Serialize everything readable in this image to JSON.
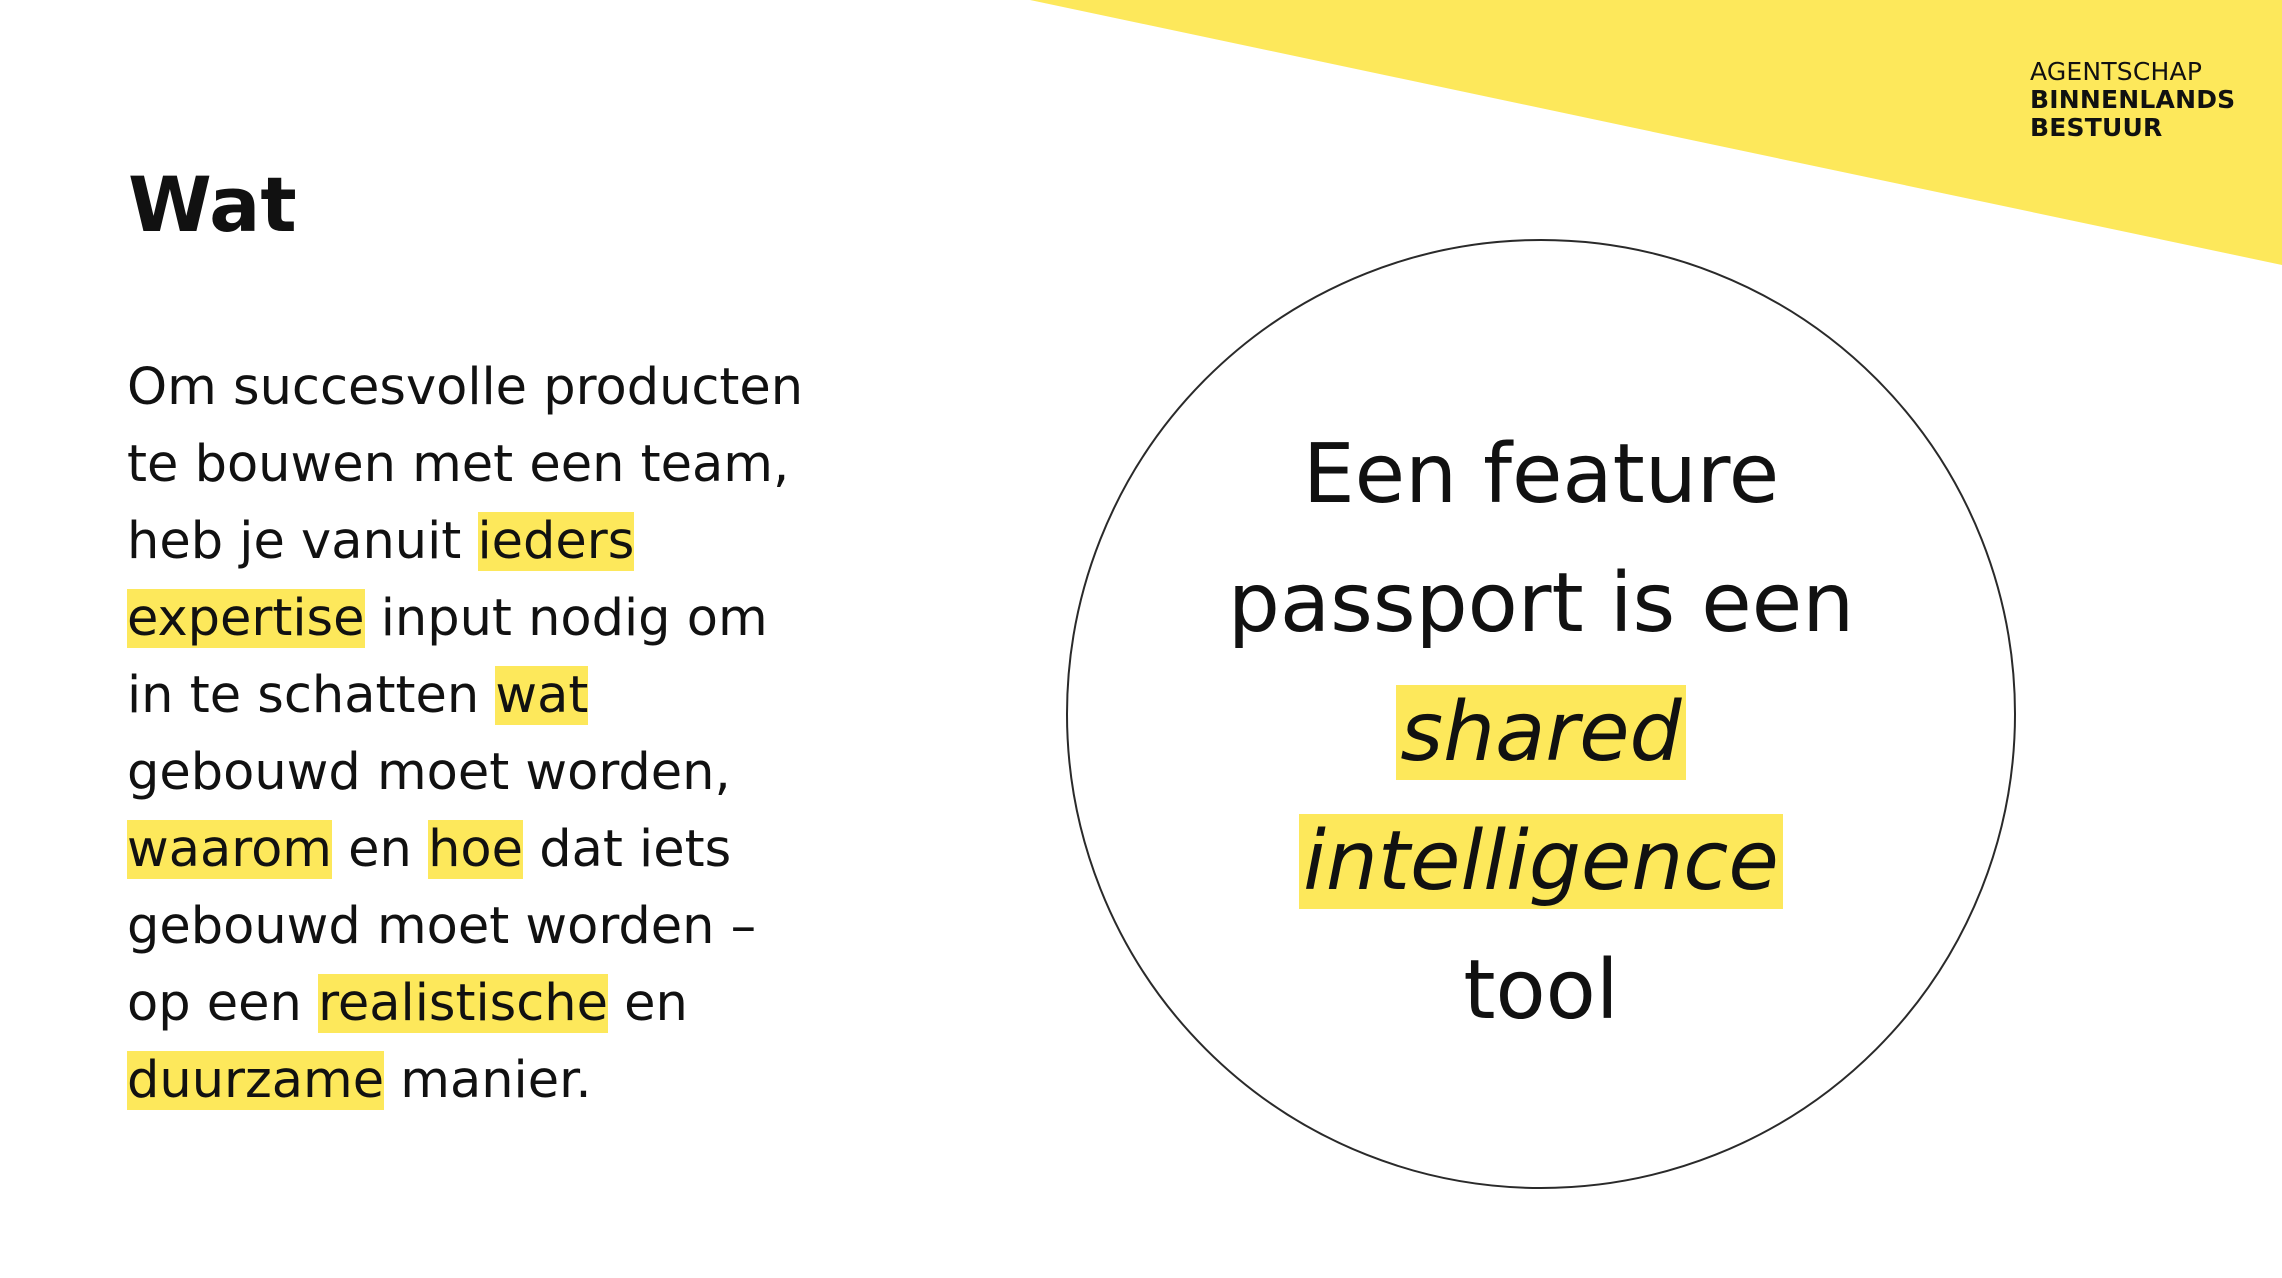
{
  "logo": {
    "line1": "AGENTSCHAP",
    "line2": "BINNENLANDS",
    "line3": "BESTUUR"
  },
  "title": "Wat",
  "body": {
    "s1": "Om succesvolle producten te bouwen met een team, heb je vanuit ",
    "h1": "ieders expertise",
    "s2": " input nodig om in te schatten ",
    "h2": "wat",
    "s3": " gebouwd moet worden, ",
    "h3": "waarom",
    "s4": " en ",
    "h4": "hoe",
    "s5": " dat iets gebouwd moet worden – op een ",
    "h5": "realistische",
    "s6": " en ",
    "h6": "duurzame",
    "s7": " manier."
  },
  "circle": {
    "line1": "Een feature",
    "line2": "passport is een",
    "line3": "shared",
    "line4": "intelligence",
    "line5": "tool"
  },
  "colors": {
    "accent_yellow": "#fde85b",
    "text": "#111111",
    "background": "#ffffff"
  }
}
